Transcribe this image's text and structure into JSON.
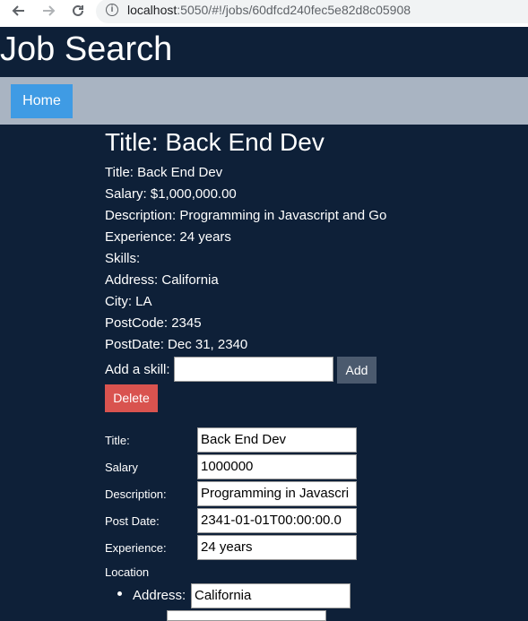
{
  "browser": {
    "host": "localhost",
    "path": ":5050/#!/jobs/60dfcd240fec5e82d8c05908"
  },
  "site": {
    "title": "Job Search"
  },
  "nav": {
    "home_label": "Home"
  },
  "job": {
    "heading": "Title: Back End Dev",
    "title_line": "Title: Back End Dev",
    "salary_line": "Salary: $1,000,000.00",
    "description_line": "Description: Programming in Javascript and Go",
    "experience_line": "Experience: 24 years",
    "skills_line": "Skills:",
    "address_line": "Address: California",
    "city_line": "City: LA",
    "postcode_line": "PostCode: 2345",
    "postdate_line": "PostDate: Dec 31, 2340"
  },
  "skill_form": {
    "label": "Add a skill:",
    "value": "",
    "add_label": "Add"
  },
  "delete_label": "Delete",
  "edit_form": {
    "title_label": "Title:",
    "title_value": "Back End Dev",
    "salary_label": "Salary",
    "salary_value": "1000000",
    "description_label": "Description:",
    "description_value": "Programming in Javascri",
    "postdate_label": "Post Date:",
    "postdate_value": "2341-01-01T00:00:00.0",
    "experience_label": "Experience:",
    "experience_value": "24 years",
    "location_label": "Location",
    "address_label": "Address:",
    "address_value": "California"
  }
}
